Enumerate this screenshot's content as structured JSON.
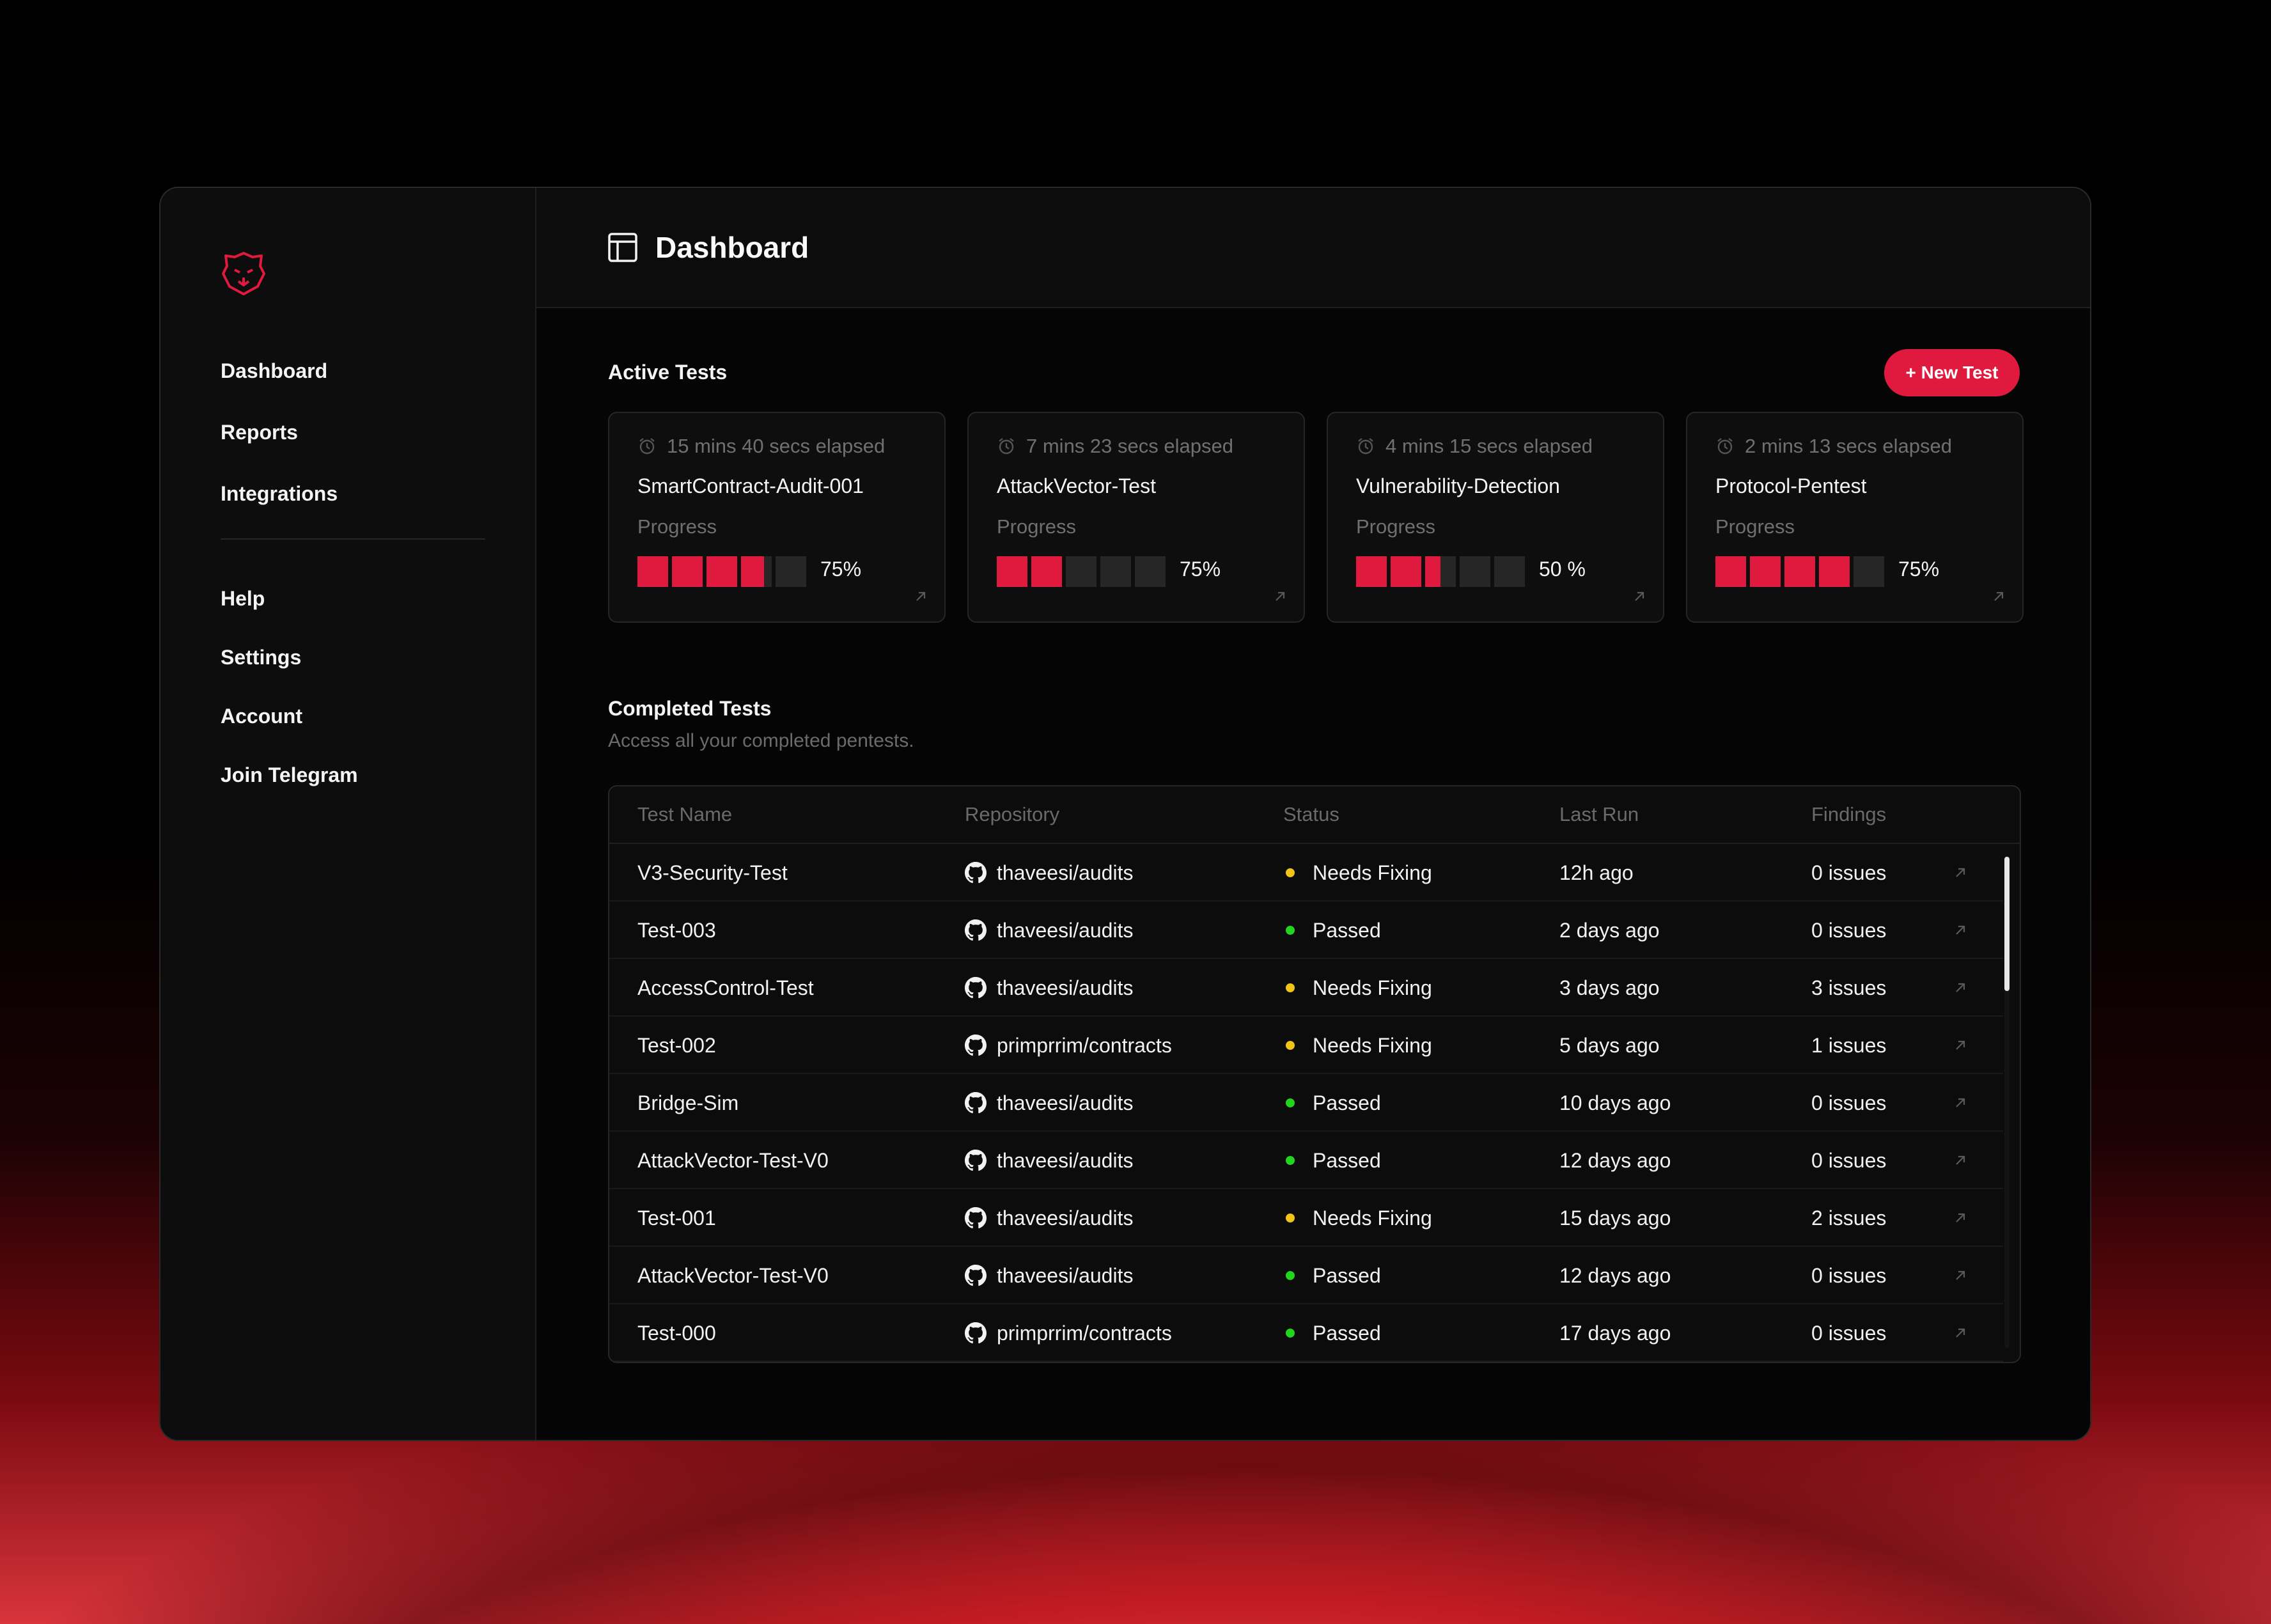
{
  "sidebar": {
    "primary": [
      {
        "label": "Dashboard"
      },
      {
        "label": "Reports"
      },
      {
        "label": "Integrations"
      }
    ],
    "secondary": [
      {
        "label": "Help"
      },
      {
        "label": "Settings"
      },
      {
        "label": "Account"
      },
      {
        "label": "Join Telegram"
      }
    ]
  },
  "header": {
    "title": "Dashboard",
    "icon": "layout-icon"
  },
  "active_tests": {
    "title": "Active Tests",
    "new_button": "+ New Test",
    "cards": [
      {
        "elapsed": "15 mins 40 secs elapsed",
        "name": "SmartContract-Audit-001",
        "progress_label": "Progress",
        "percent_text": "75%",
        "progress": 0.75
      },
      {
        "elapsed": "7 mins 23 secs elapsed",
        "name": "AttackVector-Test",
        "progress_label": "Progress",
        "percent_text": "75%",
        "progress": 0.4
      },
      {
        "elapsed": "4 mins 15 secs elapsed",
        "name": "Vulnerability-Detection",
        "progress_label": "Progress",
        "percent_text": "50 %",
        "progress": 0.5
      },
      {
        "elapsed": "2 mins 13 secs elapsed",
        "name": "Protocol-Pentest",
        "progress_label": "Progress",
        "percent_text": "75%",
        "progress": 0.8
      }
    ]
  },
  "completed_tests": {
    "title": "Completed Tests",
    "subtitle": "Access all your completed pentests.",
    "columns": [
      "Test Name",
      "Repository",
      "Status",
      "Last Run",
      "Findings"
    ],
    "rows": [
      {
        "name": "V3-Security-Test",
        "repo": "thaveesi/audits",
        "status": "Needs Fixing",
        "last_run": "12h ago",
        "findings": "0 issues"
      },
      {
        "name": "Test-003",
        "repo": "thaveesi/audits",
        "status": "Passed",
        "last_run": "2 days ago",
        "findings": "0 issues"
      },
      {
        "name": "AccessControl-Test",
        "repo": "thaveesi/audits",
        "status": "Needs Fixing",
        "last_run": "3 days ago",
        "findings": "3 issues"
      },
      {
        "name": "Test-002",
        "repo": "primprrim/contracts",
        "status": "Needs Fixing",
        "last_run": "5 days ago",
        "findings": "1 issues"
      },
      {
        "name": "Bridge-Sim",
        "repo": "thaveesi/audits",
        "status": "Passed",
        "last_run": "10 days ago",
        "findings": "0 issues"
      },
      {
        "name": "AttackVector-Test-V0",
        "repo": "thaveesi/audits",
        "status": "Passed",
        "last_run": "12 days ago",
        "findings": "0 issues"
      },
      {
        "name": "Test-001",
        "repo": "thaveesi/audits",
        "status": "Needs Fixing",
        "last_run": "15 days ago",
        "findings": "2 issues"
      },
      {
        "name": "AttackVector-Test-V0",
        "repo": "thaveesi/audits",
        "status": "Passed",
        "last_run": "12 days ago",
        "findings": "0 issues"
      },
      {
        "name": "Test-000",
        "repo": "primprrim/contracts",
        "status": "Passed",
        "last_run": "17 days ago",
        "findings": "0 issues"
      }
    ]
  },
  "colors": {
    "accent": "#e01a3e",
    "passed": "#22d41e",
    "needs_fixing": "#f2c417"
  }
}
